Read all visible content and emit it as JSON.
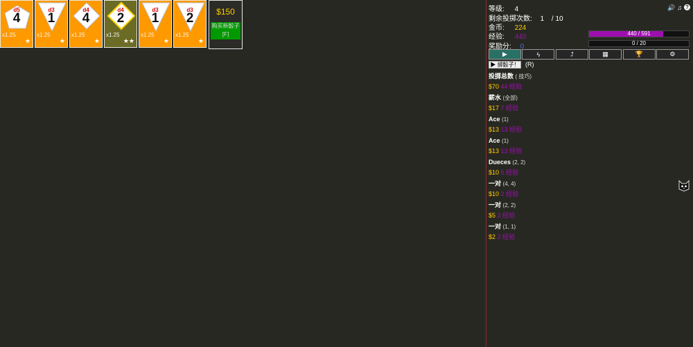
{
  "dice": [
    {
      "type": "d5",
      "value": "4",
      "mult": "x1.25",
      "stars": "★",
      "shape": "pentagon",
      "bg": "#ff9900"
    },
    {
      "type": "d3",
      "value": "1",
      "mult": "x1.25",
      "stars": "★",
      "shape": "triangle",
      "bg": "#ff9900"
    },
    {
      "type": "d4",
      "value": "4",
      "mult": "x1.25",
      "stars": "★",
      "shape": "diamond",
      "bg": "#ff9900"
    },
    {
      "type": "d4",
      "value": "2",
      "mult": "x1.25",
      "stars": "★★",
      "shape": "diamond",
      "bg": "#6b6b26"
    },
    {
      "type": "d3",
      "value": "1",
      "mult": "x1.25",
      "stars": "★",
      "shape": "triangle",
      "bg": "#ff9900"
    },
    {
      "type": "d3",
      "value": "2",
      "mult": "x1.25",
      "stars": "★",
      "shape": "triangle",
      "bg": "#ff9900"
    }
  ],
  "shop": {
    "price": "$150",
    "buy_label": "购买新骰子 [F]"
  },
  "stats": {
    "level_label": "等级:",
    "level_value": "4",
    "rolls_label": "剩余投掷次数:",
    "rolls_value": "1",
    "rolls_total": "/ 10",
    "gold_label": "金币:",
    "gold_value": "224",
    "xp_label": "经验:",
    "xp_value": "440",
    "bonus_label": "奖励分:",
    "bonus_value": "0"
  },
  "xp_bar": {
    "text": "440 / 591",
    "fraction": 0.745
  },
  "bonus_bar": {
    "text": "0 / 20",
    "fraction": 0.0
  },
  "tabs": [
    {
      "icon": "play-icon",
      "glyph": "▶"
    },
    {
      "icon": "lightning-icon",
      "glyph": "ϟ"
    },
    {
      "icon": "upgrade-arrow-icon",
      "glyph": "⮥"
    },
    {
      "icon": "stats-chart-icon",
      "glyph": "▦"
    },
    {
      "icon": "trophy-icon",
      "glyph": "🏆"
    },
    {
      "icon": "gears-icon",
      "glyph": "⚙"
    }
  ],
  "roll_button": "▶ 掷骰子！",
  "roll_hotkey": "(R)",
  "scores": [
    {
      "name": "投掷总数",
      "detail": "( 技巧)",
      "gold": "$70",
      "xp": "44 经验"
    },
    {
      "name": "薪水",
      "detail": "(全部)",
      "gold": "$17",
      "xp": "7 经验"
    },
    {
      "name": "Ace",
      "detail": "(1)",
      "gold": "$13",
      "xp": "13 经验"
    },
    {
      "name": "Ace",
      "detail": "(1)",
      "gold": "$13",
      "xp": "13 经验"
    },
    {
      "name": "Dueces",
      "detail": "(2, 2)",
      "gold": "$10",
      "xp": "5 经验"
    },
    {
      "name": "一对",
      "detail": "(4, 4)",
      "gold": "$10",
      "xp": "2 经验"
    },
    {
      "name": "一对",
      "detail": "(2, 2)",
      "gold": "$5",
      "xp": "2 经验"
    },
    {
      "name": "一对",
      "detail": "(1, 1)",
      "gold": "$2",
      "xp": "2 经验"
    }
  ],
  "top_icons": [
    "speaker-icon",
    "music-icon",
    "help-icon"
  ],
  "colors": {
    "gold": "#ffcc00",
    "xp": "#9e0fb0",
    "die_orange": "#ff9900",
    "die_olive": "#6b6b26",
    "buy_green": "#009900",
    "active_tab": "#297065"
  }
}
